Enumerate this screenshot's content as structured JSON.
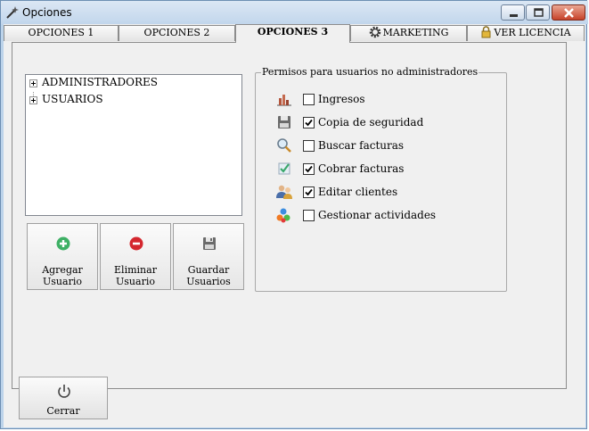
{
  "window": {
    "title": "Opciones"
  },
  "tabs": [
    {
      "label": "OPCIONES 1"
    },
    {
      "label": "OPCIONES 2"
    },
    {
      "label": "OPCIONES 3",
      "active": true
    },
    {
      "label": "MARKETING",
      "icon": "gear-icon"
    },
    {
      "label": "VER LICENCIA",
      "icon": "lock-icon"
    }
  ],
  "tree": {
    "items": [
      {
        "label": "ADMINISTRADORES",
        "expanded": false
      },
      {
        "label": "USUARIOS",
        "expanded": false
      }
    ]
  },
  "actions": {
    "add": {
      "line1": "Agregar",
      "line2": "Usuario",
      "icon": "add-circle-icon"
    },
    "remove": {
      "line1": "Eliminar",
      "line2": "Usuario",
      "icon": "remove-circle-icon"
    },
    "save": {
      "line1": "Guardar",
      "line2": "Usuarios",
      "icon": "floppy-disk-icon"
    }
  },
  "permissions": {
    "legend": "Permisos para usuarios no administradores",
    "items": [
      {
        "label": "Ingresos",
        "checked": false,
        "icon": "bar-chart-icon"
      },
      {
        "label": "Copia de seguridad",
        "checked": true,
        "icon": "floppy-disk-icon"
      },
      {
        "label": "Buscar facturas",
        "checked": false,
        "icon": "magnifier-icon"
      },
      {
        "label": "Cobrar facturas",
        "checked": true,
        "icon": "check-document-icon"
      },
      {
        "label": "Editar clientes",
        "checked": true,
        "icon": "users-icon"
      },
      {
        "label": "Gestionar actividades",
        "checked": false,
        "icon": "colored-shapes-icon"
      }
    ]
  },
  "close": {
    "label": "Cerrar",
    "icon": "power-icon"
  },
  "colors": {
    "titlebar": "#c7d9ee",
    "client": "#f0f0f0",
    "close_button": "#c7432a"
  }
}
